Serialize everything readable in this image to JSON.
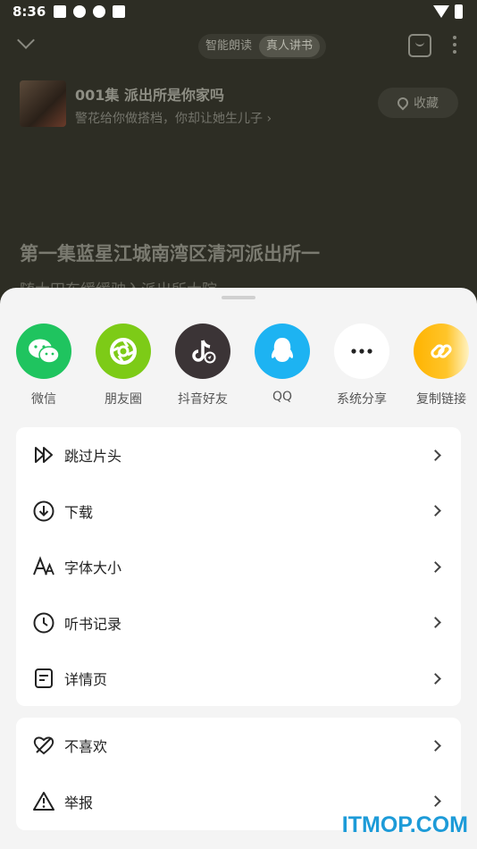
{
  "status_bar": {
    "time": "8:36"
  },
  "top_nav": {
    "mode_tts": "智能朗读",
    "mode_human": "真人讲书"
  },
  "book": {
    "episode_title": "001集 派出所是你家吗",
    "episode_subtitle": "警花给你做搭档，你却让她生儿子 ›",
    "collect_label": "收藏"
  },
  "content": {
    "chapter_title": "第一集蓝星江城南湾区清河派出所一",
    "chapter_text": "随大田东缓缓驶入派出所大院"
  },
  "share": {
    "items": [
      {
        "label": "微信",
        "icon": "wechat-icon",
        "color": "#1fc45f"
      },
      {
        "label": "朋友圈",
        "icon": "moments-icon",
        "color": "#7dcb17"
      },
      {
        "label": "抖音好友",
        "icon": "douyin-icon",
        "color": "#3b3436"
      },
      {
        "label": "QQ",
        "icon": "qq-icon",
        "color": "#1db3f2"
      },
      {
        "label": "系统分享",
        "icon": "more-icon",
        "color": "#ffffff"
      },
      {
        "label": "复制链接",
        "icon": "link-icon",
        "color": "#ffb300"
      }
    ]
  },
  "menu": {
    "group1": [
      {
        "label": "跳过片头",
        "icon": "skip-intro-icon"
      },
      {
        "label": "下载",
        "icon": "download-icon"
      },
      {
        "label": "字体大小",
        "icon": "font-size-icon"
      },
      {
        "label": "听书记录",
        "icon": "history-icon"
      },
      {
        "label": "详情页",
        "icon": "details-icon"
      }
    ],
    "group2": [
      {
        "label": "不喜欢",
        "icon": "dislike-icon"
      },
      {
        "label": "举报",
        "icon": "report-icon"
      }
    ]
  },
  "watermark": "ITMOP.COM"
}
